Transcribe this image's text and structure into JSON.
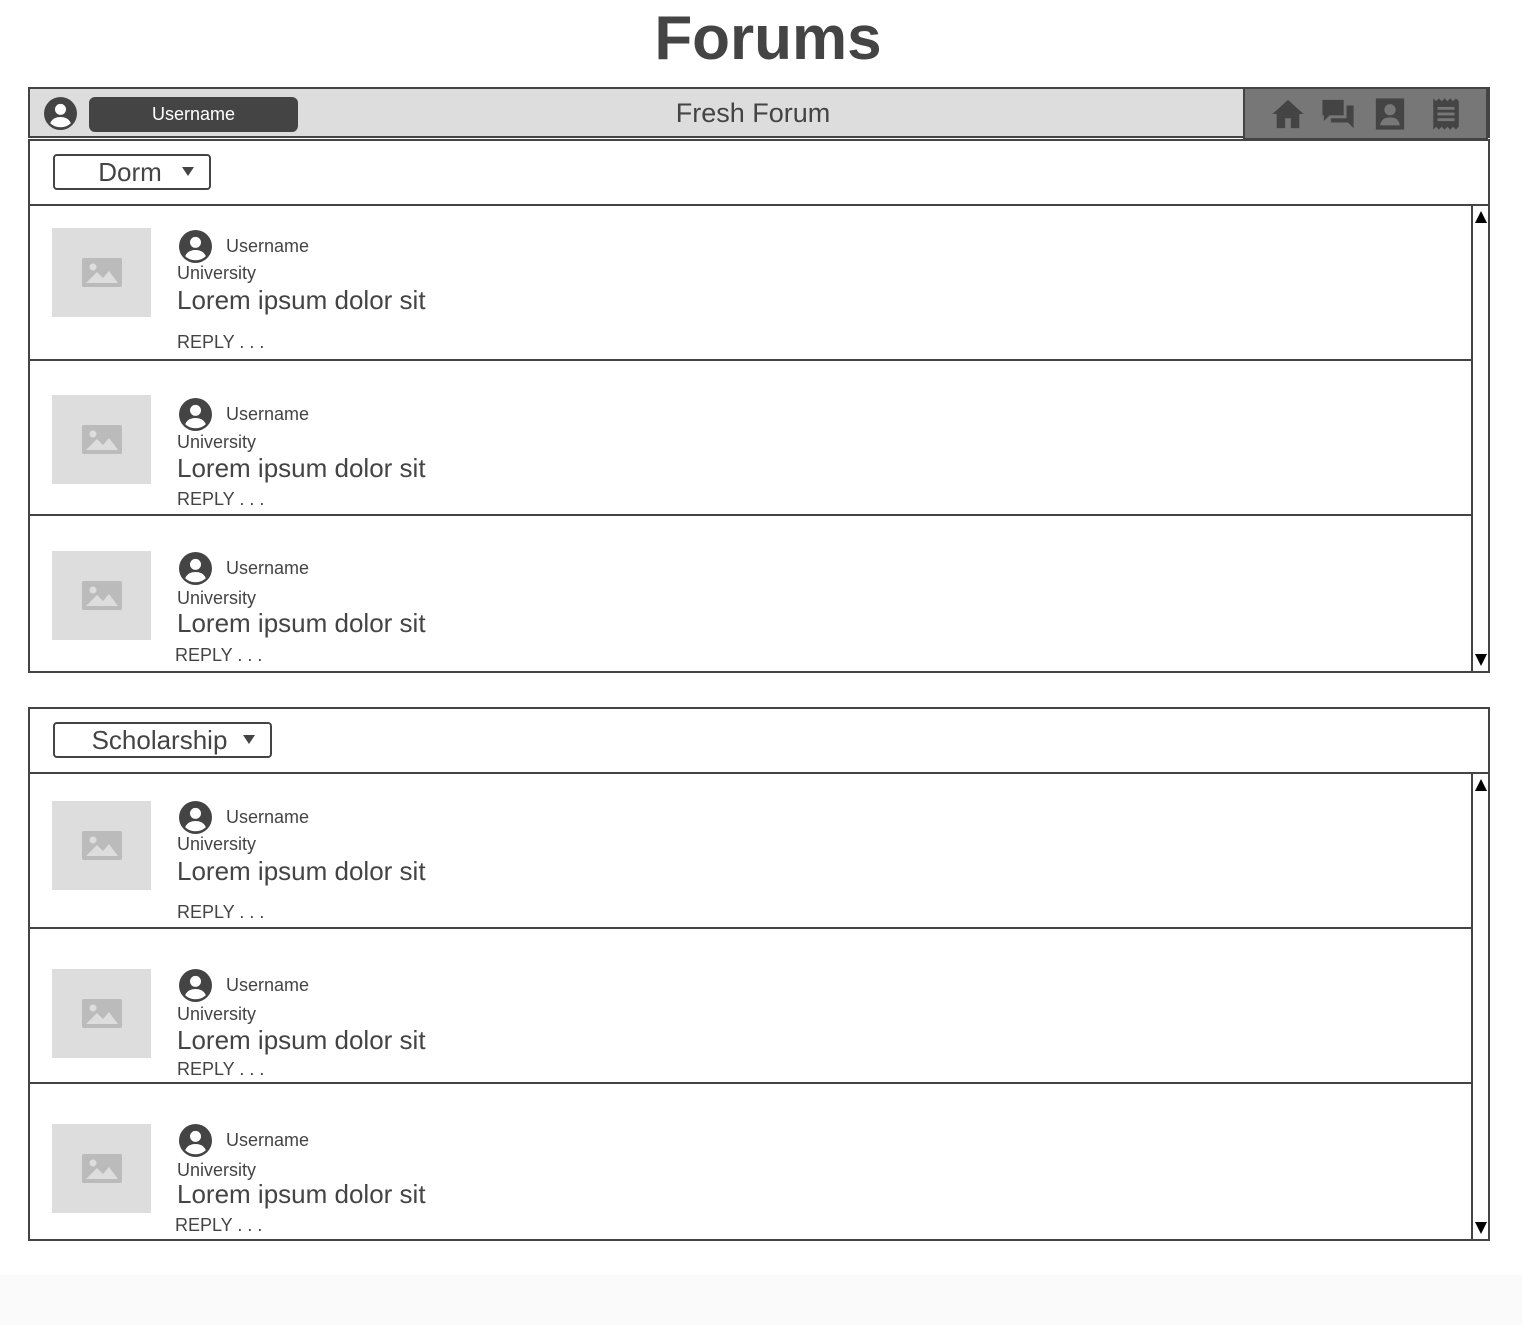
{
  "page": {
    "title": "Forums"
  },
  "header": {
    "username": "Username",
    "app_title": "Fresh Forum",
    "nav_icons": [
      "home-icon",
      "chat-icon",
      "profile-card-icon",
      "receipt-icon"
    ]
  },
  "sections": [
    {
      "category": "Dorm",
      "posts": [
        {
          "username": "Username",
          "university": "University",
          "text": "Lorem ipsum dolor sit",
          "reply": "REPLY . . ."
        },
        {
          "username": "Username",
          "university": "University",
          "text": "Lorem ipsum dolor sit",
          "reply": "REPLY . . ."
        },
        {
          "username": "Username",
          "university": "University",
          "text": "Lorem ipsum dolor sit",
          "reply": "REPLY . . ."
        }
      ]
    },
    {
      "category": "Scholarship",
      "posts": [
        {
          "username": "Username",
          "university": "University",
          "text": "Lorem ipsum dolor sit",
          "reply": "REPLY . . ."
        },
        {
          "username": "Username",
          "university": "University",
          "text": "Lorem ipsum dolor sit",
          "reply": "REPLY . . ."
        },
        {
          "username": "Username",
          "university": "University",
          "text": "Lorem ipsum dolor sit",
          "reply": "REPLY . . ."
        }
      ]
    }
  ],
  "colors": {
    "text": "#444444",
    "header_bg": "#dddddd",
    "nav_bg": "#777777",
    "placeholder": "#dddddd"
  }
}
